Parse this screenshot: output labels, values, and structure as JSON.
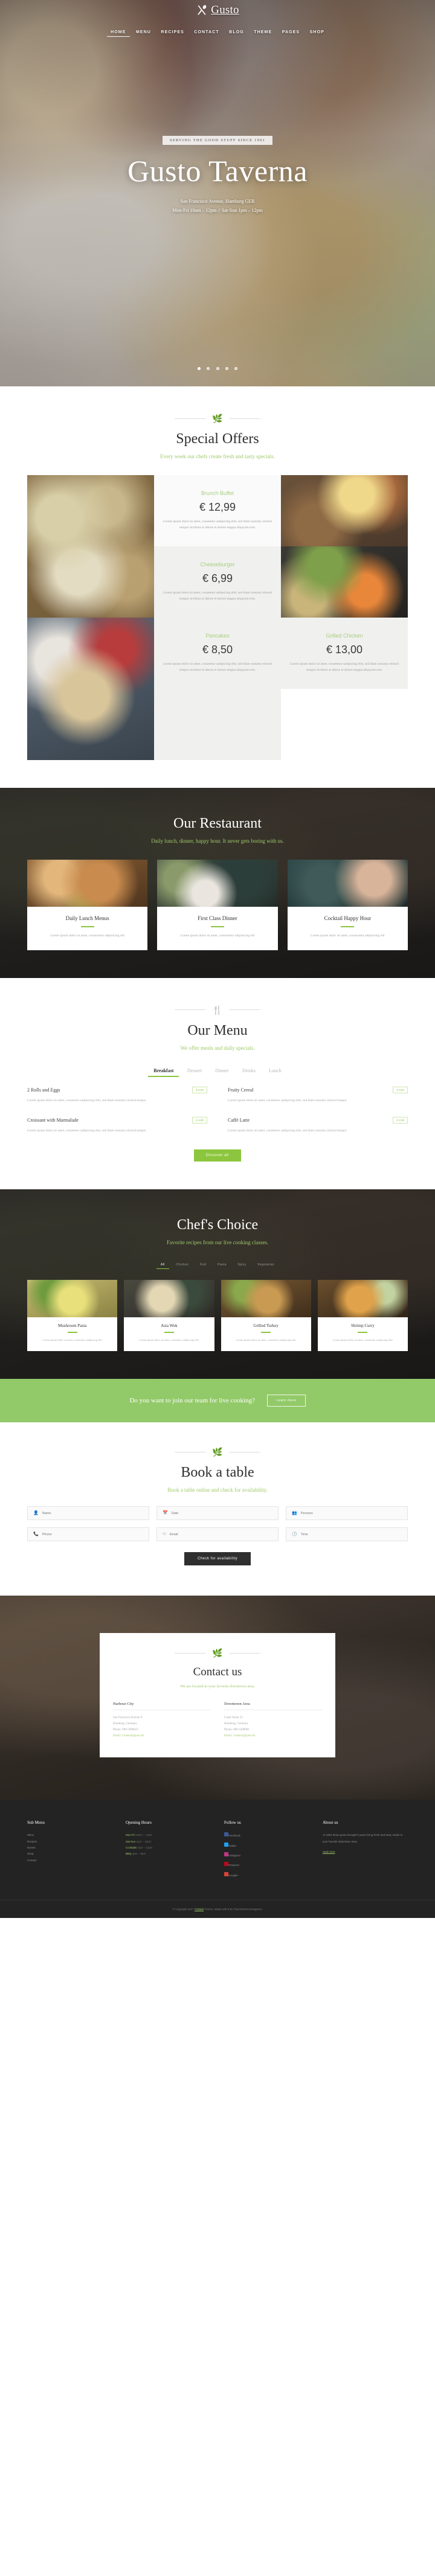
{
  "brand": {
    "name": "Gusto",
    "icon": "fork-spoon-logo-icon"
  },
  "nav": {
    "items": [
      {
        "label": "HOME",
        "active": true
      },
      {
        "label": "MENU",
        "active": false
      },
      {
        "label": "RECIPES",
        "active": false
      },
      {
        "label": "CONTACT",
        "active": false
      },
      {
        "label": "BLOG",
        "active": false
      },
      {
        "label": "THEME",
        "active": false
      },
      {
        "label": "PAGES",
        "active": false
      },
      {
        "label": "SHOP",
        "active": false
      }
    ]
  },
  "hero": {
    "tagline": "SERVING THE GOOD STUFF SINCE 1991",
    "title": "Gusto Taverna",
    "address": "San Francisco Avenue, Hamburg GER",
    "hours": "Mon-Fri 10am – 12pm // Sat-Sun 1pm – 12pm",
    "slides": 5,
    "active_slide": 1
  },
  "offers": {
    "title": "Special Offers",
    "subtitle": "Every week our chefs create fresh and tasty specials.",
    "ornament_icon": "leaf-icon",
    "lorem": "Lorem ipsum dolor sit amet, consetetur sadipscing elitr, sed diam nonumy eirmod tempor invidunt ut labore et dolore magna aliquyam erat.",
    "items": [
      {
        "name": "Brunch Buffet",
        "price": "€ 12,99"
      },
      {
        "name": "Cheeseburger",
        "price": "€ 6,99"
      },
      {
        "name": "Grilled Chicken",
        "price": "€ 13,00"
      },
      {
        "name": "Pancakes",
        "price": "€ 8,50"
      }
    ]
  },
  "restaurant": {
    "title": "Our Restaurant",
    "subtitle": "Daily lunch, dinner, happy hour. It never gets boring with us.",
    "cards": [
      {
        "title": "Daily Lunch Menus",
        "desc": "Lorem ipsum dolor sit amet, consectetur adipisicing elit"
      },
      {
        "title": "First Class Dinner",
        "desc": "Lorem ipsum dolor sit amet, consectetur adipisicing elit"
      },
      {
        "title": "Cocktail Happy Hour",
        "desc": "Lorem ipsum dolor sit amet, consectetur adipisicing elit"
      }
    ]
  },
  "menu": {
    "title": "Our Menu",
    "subtitle": "We offer meals and daily specials.",
    "ornament_icon": "fork-knife-icon",
    "tabs": [
      {
        "label": "Breakfast",
        "active": true
      },
      {
        "label": "Dessert",
        "active": false
      },
      {
        "label": "Dinner",
        "active": false
      },
      {
        "label": "Drinks",
        "active": false
      },
      {
        "label": "Lunch",
        "active": false
      }
    ],
    "desc": "Lorem ipsum dolor sit amet, consetetur sadipscing elitr, sed diam nonumy eirmod tempor",
    "items": [
      {
        "name": "2 Rolls and Eggs",
        "price": "€ 5,90"
      },
      {
        "name": "Fruity Cereal",
        "price": "€ 3,50"
      },
      {
        "name": "Croissant with Marmalade",
        "price": "€ 4,90"
      },
      {
        "name": "Caffè Latte",
        "price": "€ 2,50"
      }
    ],
    "button": "Discover all"
  },
  "chefs": {
    "title": "Chef's Choice",
    "subtitle": "Favorite recipes from our live cooking classes.",
    "filters": [
      {
        "label": "All",
        "active": true
      },
      {
        "label": "Chicken",
        "active": false
      },
      {
        "label": "Fish",
        "active": false
      },
      {
        "label": "Pasta",
        "active": false
      },
      {
        "label": "Spicy",
        "active": false
      },
      {
        "label": "Vegetarian",
        "active": false
      }
    ],
    "desc": "Lorem ipsum dolor sit amet, consetetur sadipscing elitr",
    "items": [
      {
        "title": "Mushroom Pasta"
      },
      {
        "title": "Asia Wok"
      },
      {
        "title": "Grilled Turkey"
      },
      {
        "title": "Shrimp Curry"
      }
    ]
  },
  "cta": {
    "text": "Do you want to join our team for live cooking?",
    "button": "Learn more"
  },
  "book": {
    "title": "Book a table",
    "subtitle": "Book a table online and check for availability.",
    "ornament_icon": "leaf-icon",
    "fields": [
      {
        "name": "name",
        "placeholder": "Name",
        "icon": "user-icon",
        "value": ""
      },
      {
        "name": "date",
        "placeholder": "Date",
        "icon": "calendar-icon",
        "value": ""
      },
      {
        "name": "persons",
        "placeholder": "Persons",
        "icon": "users-icon",
        "value": ""
      },
      {
        "name": "phone",
        "placeholder": "Phone",
        "icon": "phone-icon",
        "value": ""
      },
      {
        "name": "email",
        "placeholder": "Email",
        "icon": "mail-icon",
        "value": ""
      },
      {
        "name": "time",
        "placeholder": "Time",
        "icon": "clock-icon",
        "value": ""
      }
    ],
    "button": "Check for availability"
  },
  "contact": {
    "title": "Contact us",
    "subtitle": "We are located in your favorite downtown area.",
    "ornament_icon": "leaf-icon",
    "locations": [
      {
        "heading": "Harbour City",
        "line1": "San Francisco Avenue 8",
        "line2": "Hamburg, Germany",
        "phone": "Phone: 089-5980023",
        "email": "Email: Contact@gusto.de"
      },
      {
        "heading": "Downtown Area",
        "line1": "Canal Street 22",
        "line2": "Hamburg, Germany",
        "phone": "Phone: 089-5408981",
        "email": "Email: Contact@gusto.de"
      }
    ]
  },
  "footer": {
    "columns": [
      {
        "heading": "Sub Menu",
        "type": "links",
        "links": [
          "Menu",
          "Recipes",
          "Events",
          "Shop",
          "Contact"
        ]
      },
      {
        "heading": "Opening Hours",
        "type": "hours",
        "rows": [
          {
            "label": "Mon-Fri",
            "value": "10am – 12pm"
          },
          {
            "label": "Sat-Sun",
            "value": "1pm – 12pm"
          },
          {
            "label": "Cocktails",
            "value": "7pm – 12pm"
          },
          {
            "label": "BBQ",
            "value": "2pm – 9pm"
          }
        ]
      },
      {
        "heading": "Follow us",
        "type": "social",
        "links": [
          "Facebook",
          "Twitter",
          "Instagram",
          "Pinterest",
          "Google+"
        ]
      },
      {
        "heading": "About us",
        "type": "about",
        "text": "At 1991 times gusto brought it years bring fresh and tasty meals to your favorite downtown area.",
        "readmore": "read more"
      }
    ],
    "copyright": "© Copyright 2017 ",
    "copyright_link": "TGWeb",
    "copyright_rest": " Theme. Made with ♥ by Themeforest Designers."
  }
}
